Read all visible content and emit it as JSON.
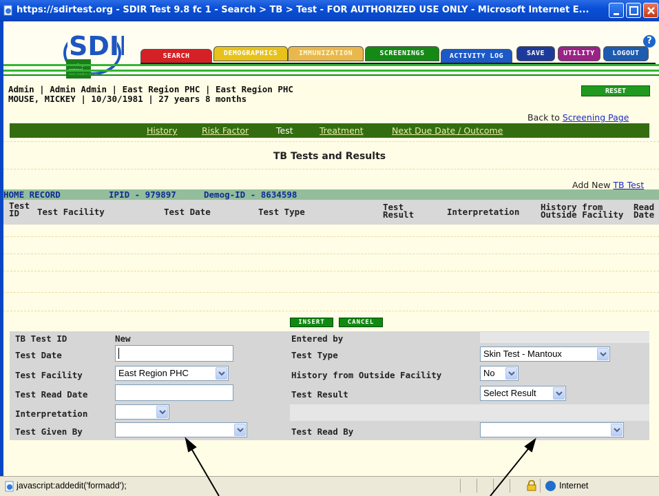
{
  "window": {
    "title": "https://sdirtest.org - SDIR Test 9.8 fc 1 - Search > TB > Test - FOR AUTHORIZED USE ONLY - Microsoft Internet E..."
  },
  "header": {
    "help_label": "?",
    "tabs": {
      "search": "SEARCH",
      "demographics": "DEMOGRAPHICS",
      "immunization": "IMMUNIZATION",
      "screenings": "SCREENINGS",
      "activity_log": "ACTIVITY LOG",
      "save": "SAVE",
      "utility": "UTILITY",
      "logout": "LOGOUT"
    }
  },
  "user": {
    "line1": "Admin | Admin Admin | East Region PHC | East Region PHC",
    "line2": "MOUSE, MICKEY | 10/30/1981 | 27 years 8 months",
    "reset_label": "RESET"
  },
  "back": {
    "prefix": "Back to ",
    "link": "Screening Page"
  },
  "subnav": {
    "history": "History",
    "risk_factor": "Risk Factor",
    "test": "Test",
    "treatment": "Treatment",
    "next_due": "Next Due Date / Outcome"
  },
  "page_title": "TB Tests and Results",
  "add_new": {
    "prefix": "Add New ",
    "link": "TB Test"
  },
  "record": {
    "home": "HOME RECORD",
    "ipid": "IPID - 979897",
    "demog": "Demog-ID - 8634598"
  },
  "results_columns": {
    "test_id_1": "Test",
    "test_id_2": "ID",
    "facility": "Test Facility",
    "date": "Test Date",
    "type": "Test Type",
    "result_1": "Test",
    "result_2": "Result",
    "interpretation": "Interpretation",
    "history_1": "History from",
    "history_2": "Outside Facility",
    "read_1": "Read",
    "read_2": "Date"
  },
  "buttons": {
    "insert": "INSERT",
    "cancel": "CANCEL"
  },
  "form": {
    "tb_test_id_label": "TB Test ID",
    "tb_test_id_value": "New",
    "entered_by_label": "Entered by",
    "entered_by_value": "",
    "test_date_label": "Test Date",
    "test_date_value": "",
    "test_type_label": "Test Type",
    "test_type_value": "Skin Test - Mantoux",
    "test_facility_label": "Test Facility",
    "test_facility_value": "East Region PHC",
    "history_label": "History from Outside Facility",
    "history_value": "No",
    "test_read_date_label": "Test Read Date",
    "test_read_date_value": "",
    "test_result_label": "Test Result",
    "test_result_value": "Select Result",
    "interpretation_label": "Interpretation",
    "interpretation_value": "",
    "test_given_by_label": "Test Given By",
    "test_given_by_value": "",
    "test_read_by_label": "Test Read By",
    "test_read_by_value": ""
  },
  "statusbar": {
    "text": "javascript:addedit('formadd');",
    "zone": "Internet"
  },
  "colors": {
    "titlebar": "#0a4fd6",
    "subnav": "#336d0f",
    "record_bar": "#93bd9b",
    "link": "#1d2bbd"
  }
}
